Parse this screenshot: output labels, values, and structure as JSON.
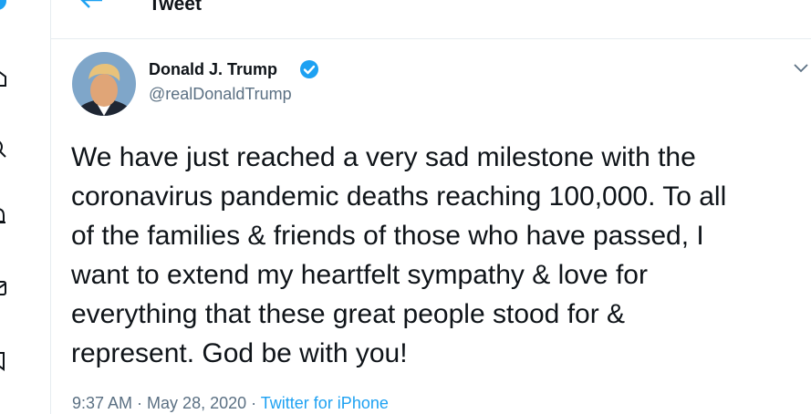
{
  "nav": {
    "icons": [
      "home-icon",
      "explore-icon",
      "notifications-icon",
      "messages-icon",
      "bookmarks-icon"
    ]
  },
  "header": {
    "back_icon": "arrow-left-icon",
    "title": "Tweet"
  },
  "tweet": {
    "author": {
      "name": "Donald J. Trump",
      "handle": "@realDonaldTrump",
      "verified": true
    },
    "text_lines": [
      "We have just reached a very sad milestone with the",
      "coronavirus pandemic deaths reaching 100,000. To all",
      "of the families & friends of those who have passed, I",
      "want to extend my heartfelt sympathy & love for",
      "everything that these great people stood for &",
      "represent. God be with you!"
    ],
    "time": "9:37 AM",
    "separator": " · ",
    "date": "May 28, 2020",
    "source": "Twitter for iPhone"
  },
  "colors": {
    "accent": "#1da1f2",
    "secondary_text": "#5b7083",
    "primary_text": "#0f1419",
    "border": "#e6ecf0"
  }
}
